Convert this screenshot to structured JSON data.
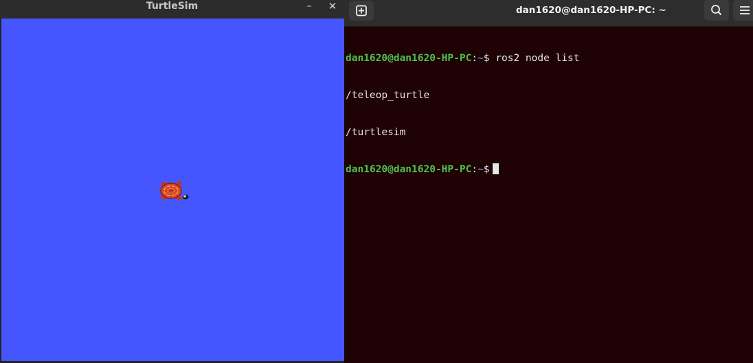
{
  "turtlesim": {
    "title": "TurtleSim",
    "minimize_glyph": "–",
    "close_glyph": "✕",
    "background_color": "#4556ff"
  },
  "terminal": {
    "title": "dan1620@dan1620-HP-PC: ~",
    "background_color": "#1e0204",
    "prompt": {
      "user_host": "dan1620@dan1620-HP-PC",
      "sep": ":",
      "path": "~",
      "symbol": "$"
    },
    "lines": [
      {
        "command": " ros2 node list"
      },
      {
        "output": "/teleop_turtle"
      },
      {
        "output": "/turtlesim"
      },
      {
        "command": " "
      }
    ],
    "icons": {
      "new_tab": "new-tab-icon",
      "search": "search-icon",
      "menu": "hamburger-menu-icon"
    }
  }
}
